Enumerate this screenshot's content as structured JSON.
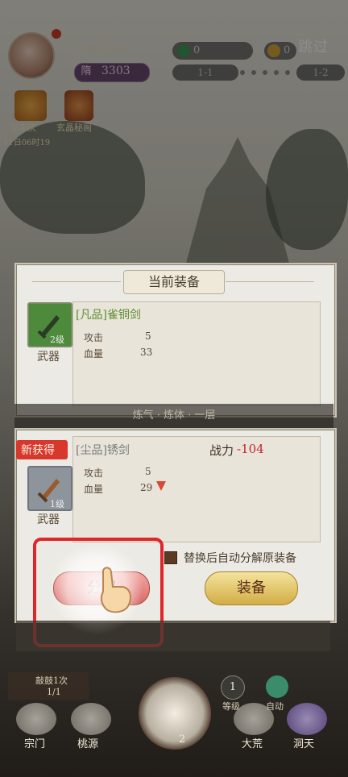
{
  "hud": {
    "player_name": "故莫文泽妨",
    "level_icon": "隋",
    "level_value": "3303",
    "res1": "0",
    "res2": "0",
    "skip": "跳过",
    "stage_left": "1-1",
    "stage_right": "1-2"
  },
  "events": {
    "anniv_label": "周年庆",
    "anniv_time": "11日06时19",
    "treasure_label": "玄晶秘阁"
  },
  "current": {
    "title": "当前装备",
    "item_name": "[凡品]雀铜剑",
    "level": "2级",
    "type": "武器",
    "stat1_label": "攻击",
    "stat1_value": "5",
    "stat2_label": "血量",
    "stat2_value": "33"
  },
  "background_hint": "炼气 · 炼体 · 一层",
  "new_item": {
    "badge": "新获得",
    "item_name": "[尘品]锈剑",
    "level": "1级",
    "type": "武器",
    "power_label": "战力",
    "power_value": "-104",
    "stat1_label": "攻击",
    "stat1_value": "5",
    "stat2_label": "血量",
    "stat2_value": "29"
  },
  "actions": {
    "auto_decompose": "替换后自动分解原装备",
    "decompose": "分解",
    "equip": "装备"
  },
  "bottom": {
    "tab1": "宗门",
    "tab2": "桃源",
    "tab3": "大荒",
    "tab4": "洞天",
    "center_count": "2",
    "quest_label": "敲鼓1次",
    "quest_progress": "1/1",
    "side1": "等级",
    "side2": "自动",
    "side1_num": "1"
  },
  "colors": {
    "accent_red": "#d8372c",
    "power_red": "#c1272d",
    "equip_gold": "#d8b74e",
    "decompose_pink": "#e7817e"
  }
}
